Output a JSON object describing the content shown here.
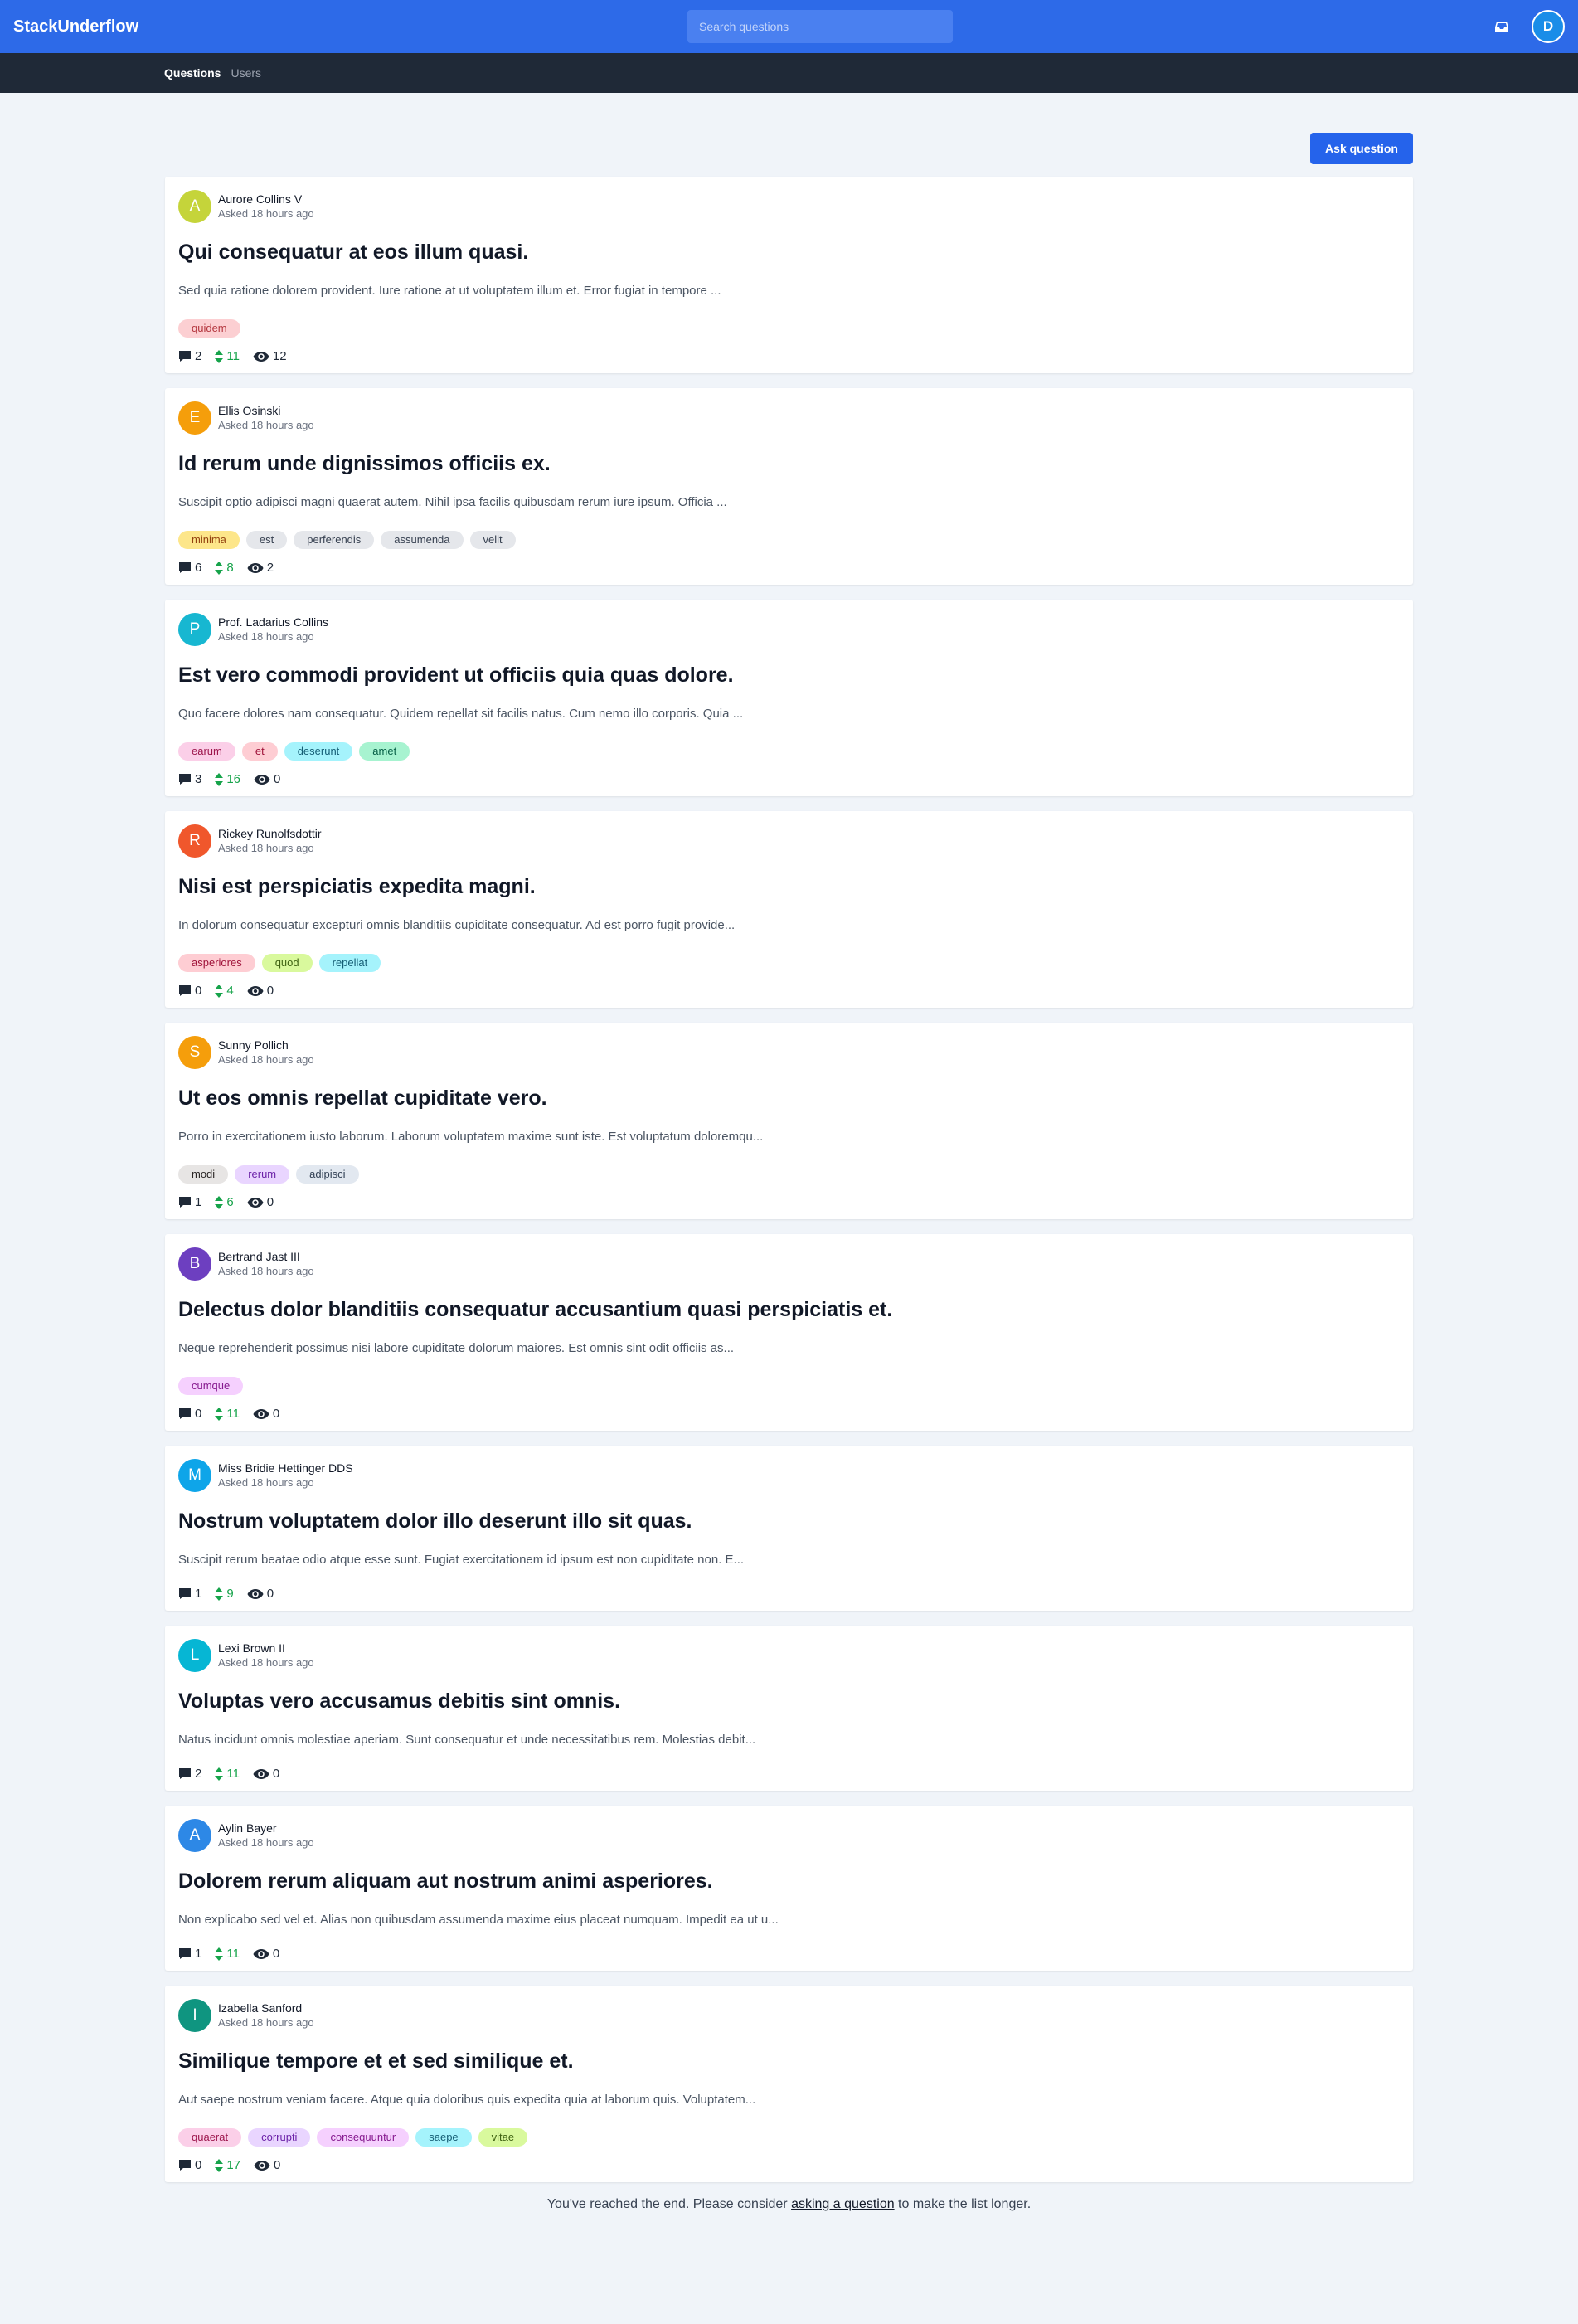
{
  "header": {
    "logo": "StackUnderflow",
    "search_placeholder": "Search questions",
    "user_initial": "D"
  },
  "nav": {
    "questions_label": "Questions",
    "users_label": "Users"
  },
  "ask_button_label": "Ask question",
  "questions": [
    {
      "author": "Aurore Collins V",
      "initial": "A",
      "avatar_color": "#c5d43a",
      "asked": "Asked 18 hours ago",
      "title": "Qui consequatur at eos illum quasi.",
      "excerpt": "Sed quia ratione dolorem provident. Iure ratione at ut voluptatem illum et. Error fugiat in tempore ...",
      "tags": [
        {
          "label": "quidem",
          "bg": "#fccfd2",
          "fg": "#b4373f"
        }
      ],
      "comments": "2",
      "votes": "11",
      "views": "12"
    },
    {
      "author": "Ellis Osinski",
      "initial": "E",
      "avatar_color": "#f59e0b",
      "asked": "Asked 18 hours ago",
      "title": "Id rerum unde dignissimos officiis ex.",
      "excerpt": "Suscipit optio adipisci magni quaerat autem. Nihil ipsa facilis quibusdam rerum iure ipsum. Officia ...",
      "tags": [
        {
          "label": "minima",
          "bg": "#fde68a",
          "fg": "#92400e"
        },
        {
          "label": "est",
          "bg": "#e5e7eb",
          "fg": "#374151"
        },
        {
          "label": "perferendis",
          "bg": "#e5e7eb",
          "fg": "#374151"
        },
        {
          "label": "assumenda",
          "bg": "#e5e7eb",
          "fg": "#374151"
        },
        {
          "label": "velit",
          "bg": "#e5e7eb",
          "fg": "#374151"
        }
      ],
      "comments": "6",
      "votes": "8",
      "views": "2"
    },
    {
      "author": "Prof. Ladarius Collins",
      "initial": "P",
      "avatar_color": "#17b7d1",
      "asked": "Asked 18 hours ago",
      "title": "Est vero commodi provident ut officiis quia quas dolore.",
      "excerpt": "Quo facere dolores nam consequatur. Quidem repellat sit facilis natus. Cum nemo illo corporis. Quia ...",
      "tags": [
        {
          "label": "earum",
          "bg": "#fbcfe8",
          "fg": "#9d174d"
        },
        {
          "label": "et",
          "bg": "#fecdd3",
          "fg": "#9f1239"
        },
        {
          "label": "deserunt",
          "bg": "#a5f3fc",
          "fg": "#155e75"
        },
        {
          "label": "amet",
          "bg": "#a7f3d0",
          "fg": "#065f46"
        }
      ],
      "comments": "3",
      "votes": "16",
      "views": "0"
    },
    {
      "author": "Rickey Runolfsdottir",
      "initial": "R",
      "avatar_color": "#f0572c",
      "asked": "Asked 18 hours ago",
      "title": "Nisi est perspiciatis expedita magni.",
      "excerpt": "In dolorum consequatur excepturi omnis blanditiis cupiditate consequatur. Ad est porro fugit provide...",
      "tags": [
        {
          "label": "asperiores",
          "bg": "#fecdd3",
          "fg": "#9f1239"
        },
        {
          "label": "quod",
          "bg": "#d9f99d",
          "fg": "#3f6212"
        },
        {
          "label": "repellat",
          "bg": "#a5f3fc",
          "fg": "#155e75"
        }
      ],
      "comments": "0",
      "votes": "4",
      "views": "0"
    },
    {
      "author": "Sunny Pollich",
      "initial": "S",
      "avatar_color": "#f59e0b",
      "asked": "Asked 18 hours ago",
      "title": "Ut eos omnis repellat cupiditate vero.",
      "excerpt": "Porro in exercitationem iusto laborum. Laborum voluptatem maxime sunt iste. Est voluptatum doloremqu...",
      "tags": [
        {
          "label": "modi",
          "bg": "#e7e5e4",
          "fg": "#292524"
        },
        {
          "label": "rerum",
          "bg": "#e9d5ff",
          "fg": "#6b21a8"
        },
        {
          "label": "adipisci",
          "bg": "#e2e8f0",
          "fg": "#334155"
        }
      ],
      "comments": "1",
      "votes": "6",
      "views": "0"
    },
    {
      "author": "Bertrand Jast III",
      "initial": "B",
      "avatar_color": "#6d3fc0",
      "asked": "Asked 18 hours ago",
      "title": "Delectus dolor blanditiis consequatur accusantium quasi perspiciatis et.",
      "excerpt": "Neque reprehenderit possimus nisi labore cupiditate dolorum maiores. Est omnis sint odit officiis as...",
      "tags": [
        {
          "label": "cumque",
          "bg": "#f5d0fe",
          "fg": "#86198f"
        }
      ],
      "comments": "0",
      "votes": "11",
      "views": "0"
    },
    {
      "author": "Miss Bridie Hettinger DDS",
      "initial": "M",
      "avatar_color": "#0ea5e9",
      "asked": "Asked 18 hours ago",
      "title": "Nostrum voluptatem dolor illo deserunt illo sit quas.",
      "excerpt": "Suscipit rerum beatae odio atque esse sunt. Fugiat exercitationem id ipsum est non cupiditate non. E...",
      "tags": [],
      "comments": "1",
      "votes": "9",
      "views": "0"
    },
    {
      "author": "Lexi Brown II",
      "initial": "L",
      "avatar_color": "#06b6d4",
      "asked": "Asked 18 hours ago",
      "title": "Voluptas vero accusamus debitis sint omnis.",
      "excerpt": "Natus incidunt omnis molestiae aperiam. Sunt consequatur et unde necessitatibus rem. Molestias debit...",
      "tags": [],
      "comments": "2",
      "votes": "11",
      "views": "0"
    },
    {
      "author": "Aylin Bayer",
      "initial": "A",
      "avatar_color": "#2d88e6",
      "asked": "Asked 18 hours ago",
      "title": "Dolorem rerum aliquam aut nostrum animi asperiores.",
      "excerpt": "Non explicabo sed vel et. Alias non quibusdam assumenda maxime eius placeat numquam. Impedit ea ut u...",
      "tags": [],
      "comments": "1",
      "votes": "11",
      "views": "0"
    },
    {
      "author": "Izabella Sanford",
      "initial": "I",
      "avatar_color": "#0f9580",
      "asked": "Asked 18 hours ago",
      "title": "Similique tempore et et sed similique et.",
      "excerpt": "Aut saepe nostrum veniam facere. Atque quia doloribus quis expedita quia at laborum quis. Voluptatem...",
      "tags": [
        {
          "label": "quaerat",
          "bg": "#fbcfe8",
          "fg": "#9d174d"
        },
        {
          "label": "corrupti",
          "bg": "#e9d5ff",
          "fg": "#6b21a8"
        },
        {
          "label": "consequuntur",
          "bg": "#f5d0fe",
          "fg": "#86198f"
        },
        {
          "label": "saepe",
          "bg": "#a5f3fc",
          "fg": "#155e75"
        },
        {
          "label": "vitae",
          "bg": "#d9f99d",
          "fg": "#3f6212"
        }
      ],
      "comments": "0",
      "votes": "17",
      "views": "0"
    }
  ],
  "footer": {
    "before": "You've reached the end. Please consider ",
    "link": "asking a question",
    "after": " to make the list longer."
  }
}
